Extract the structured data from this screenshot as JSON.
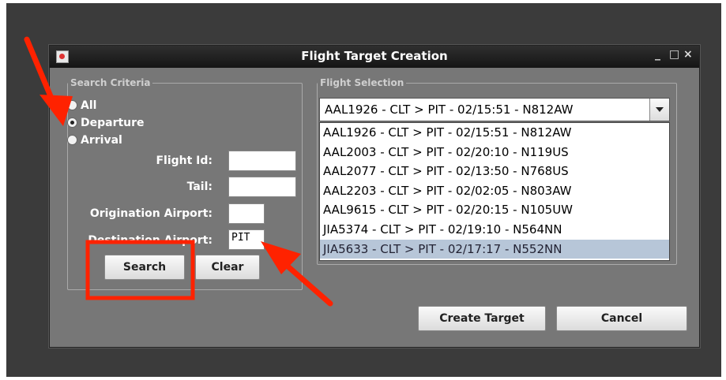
{
  "window": {
    "title": "Flight Target Creation",
    "minimize_glyph": "_",
    "maximize_glyph": "□",
    "close_glyph": "×"
  },
  "search_criteria": {
    "legend": "Search Criteria",
    "radios": [
      {
        "label": "All",
        "checked": false
      },
      {
        "label": "Departure",
        "checked": true
      },
      {
        "label": "Arrival",
        "checked": false
      }
    ],
    "fields": {
      "flight_id_label": "Flight Id:",
      "flight_id_value": "",
      "tail_label": "Tail:",
      "tail_value": "",
      "origination_label": "Origination Airport:",
      "origination_value": "",
      "destination_label": "Destination Airport:",
      "destination_value": "PIT"
    },
    "search_label": "Search",
    "clear_label": "Clear"
  },
  "flight_selection": {
    "legend": "Flight Selection",
    "selected": "AAL1926 - CLT > PIT - 02/15:51 - N812AW",
    "options": [
      "AAL1926 - CLT > PIT - 02/15:51 - N812AW",
      "AAL2003 - CLT > PIT - 02/20:10 - N119US",
      "AAL2077 - CLT > PIT - 02/13:50 - N768US",
      "AAL2203 - CLT > PIT - 02/02:05 - N803AW",
      "AAL9615 - CLT > PIT - 02/20:15 - N105UW",
      "JIA5374 - CLT > PIT - 02/19:10 - N564NN",
      "JIA5633 - CLT > PIT - 02/17:17 - N552NN"
    ],
    "highlighted_index": 6
  },
  "buttons": {
    "create_target_label": "Create Target",
    "cancel_label": "Cancel"
  },
  "colors": {
    "annotation": "#ff2200",
    "window_bg": "#777777",
    "highlight": "#b7c6d8"
  }
}
